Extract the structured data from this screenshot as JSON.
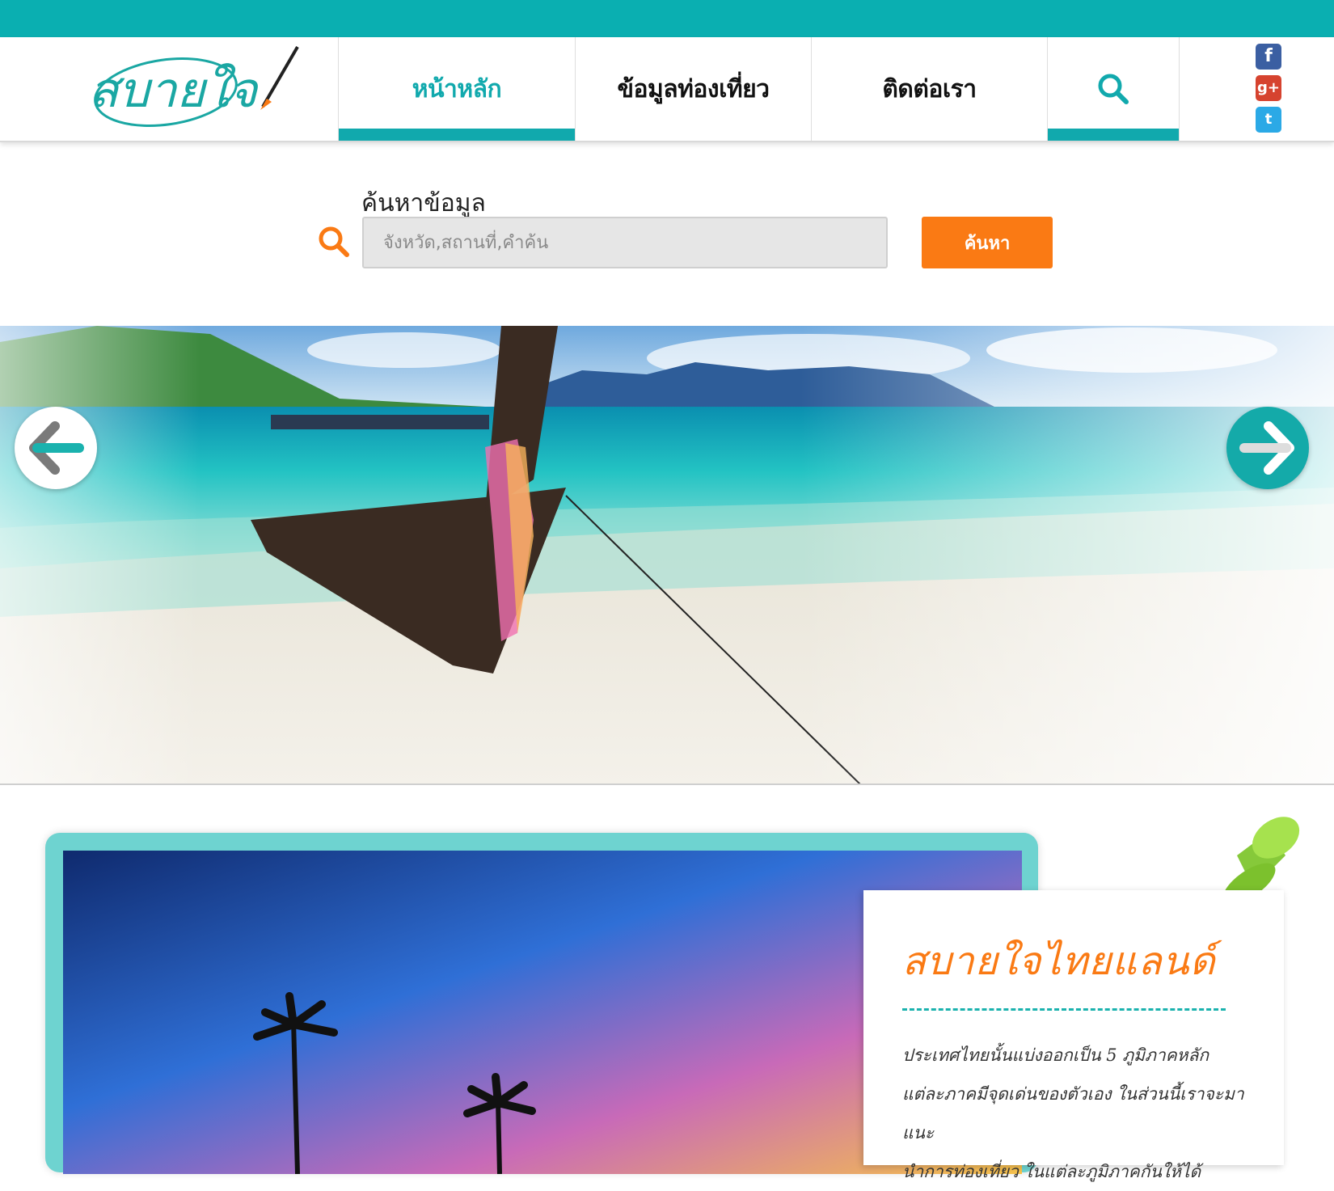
{
  "brand": {
    "logo_text": "สบายใจ"
  },
  "nav": {
    "items": [
      {
        "label": "หน้าหลัก"
      },
      {
        "label": "ข้อมูลท่องเที่ยว"
      },
      {
        "label": "ติดต่อเรา"
      }
    ],
    "search_icon": "search-icon"
  },
  "social": [
    {
      "icon": "facebook-icon",
      "glyph": "f"
    },
    {
      "icon": "google-plus-icon",
      "glyph": "g+"
    },
    {
      "icon": "twitter-icon",
      "glyph": "t"
    }
  ],
  "search": {
    "title": "ค้นหาข้อมูล",
    "placeholder": "จังหวัด,สถานที่,คำค้น",
    "button_label": "ค้นหา"
  },
  "slider": {
    "prev_icon": "arrow-left-icon",
    "next_icon": "arrow-right-icon"
  },
  "intro": {
    "title": "สบายใจไทยแลนด์",
    "lines": [
      "ประเทศไทยนั้นแบ่งออกเป็น 5 ภูมิภาคหลัก",
      "แต่ละภาคมีจุดเด่นของตัวเอง ในส่วนนี้เราจะมาแนะ",
      "นำการท่องเที่ยว ในแต่ละภูมิภาคกันให้ได้"
    ]
  },
  "colors": {
    "teal": "#0aafb1",
    "orange": "#fa7a14"
  }
}
